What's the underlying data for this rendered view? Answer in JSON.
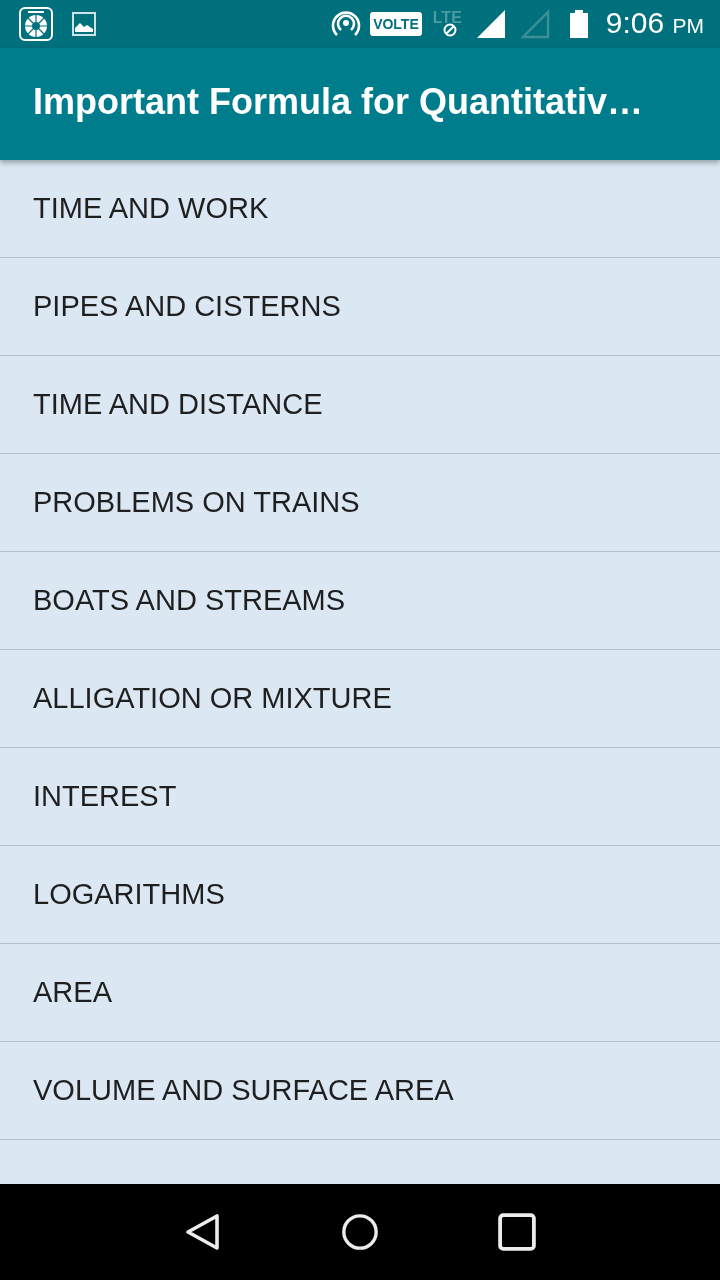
{
  "status_bar": {
    "volte_badge": "VOLTE",
    "network_type": "LTE",
    "signals": [
      {
        "connected": true
      },
      {
        "connected": false
      }
    ],
    "time": "9:06",
    "meridiem": "PM"
  },
  "app_bar": {
    "title": "Important Formula for Quantitativ…"
  },
  "topics": [
    {
      "label": "TIME AND WORK"
    },
    {
      "label": "PIPES AND CISTERNS"
    },
    {
      "label": "TIME AND DISTANCE"
    },
    {
      "label": "PROBLEMS ON TRAINS"
    },
    {
      "label": "BOATS AND STREAMS"
    },
    {
      "label": "ALLIGATION OR MIXTURE"
    },
    {
      "label": "INTEREST"
    },
    {
      "label": "LOGARITHMS"
    },
    {
      "label": "AREA"
    },
    {
      "label": "VOLUME AND SURFACE AREA"
    }
  ]
}
